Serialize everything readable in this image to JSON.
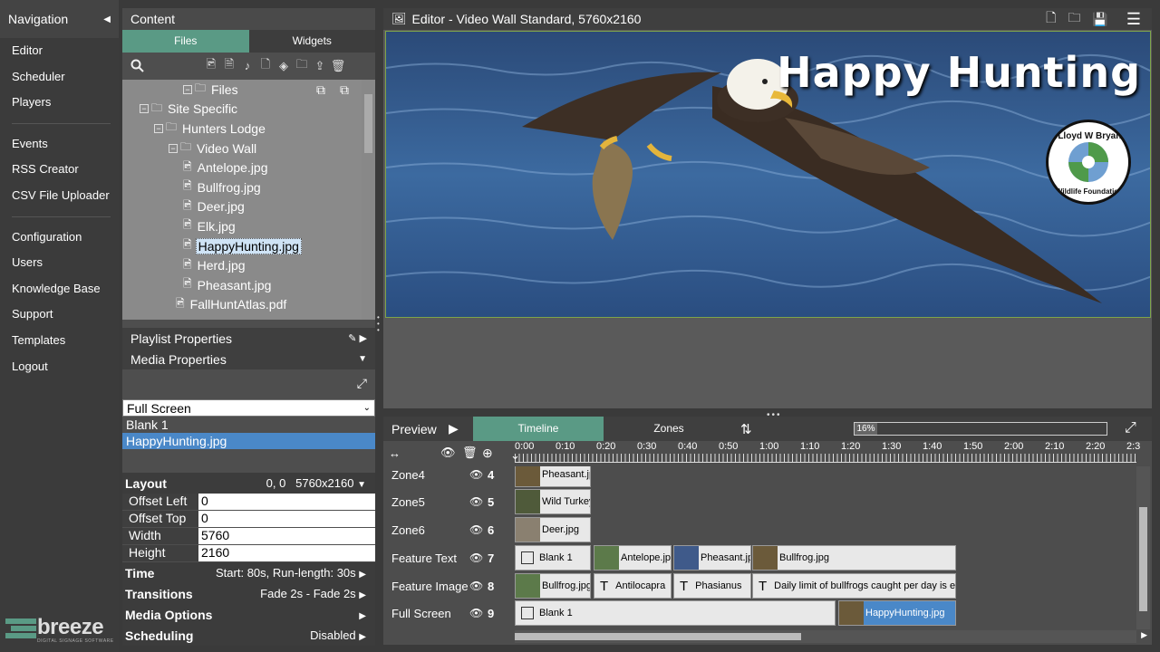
{
  "nav": {
    "title": "Navigation",
    "group1": [
      "Editor",
      "Scheduler",
      "Players"
    ],
    "group2": [
      "Events",
      "RSS Creator",
      "CSV File Uploader"
    ],
    "group3": [
      "Configuration",
      "Users",
      "Knowledge Base",
      "Support",
      "Templates",
      "Logout"
    ],
    "logo_text": "breeze",
    "logo_sub": "DIGITAL SIGNAGE SOFTWARE"
  },
  "content": {
    "title": "Content",
    "tabs": [
      "Files",
      "Widgets"
    ],
    "tree": [
      {
        "label": "Files",
        "type": "folder"
      },
      {
        "label": "Site Specific",
        "type": "folder"
      },
      {
        "label": "Hunters Lodge",
        "type": "folder"
      },
      {
        "label": "Video Wall",
        "type": "folder"
      },
      {
        "label": "Antelope.jpg",
        "type": "file"
      },
      {
        "label": "Bullfrog.jpg",
        "type": "file"
      },
      {
        "label": "Deer.jpg",
        "type": "file"
      },
      {
        "label": "Elk.jpg",
        "type": "file"
      },
      {
        "label": "HappyHunting.jpg",
        "type": "file",
        "selected": true
      },
      {
        "label": "Herd.jpg",
        "type": "file"
      },
      {
        "label": "Pheasant.jpg",
        "type": "file"
      },
      {
        "label": "FallHuntAtlas.pdf",
        "type": "file"
      }
    ],
    "playlist_properties": "Playlist Properties",
    "media_properties": "Media Properties",
    "zone_select": "Full Screen",
    "media_list": [
      "Blank 1",
      "HappyHunting.jpg"
    ],
    "layout": {
      "label": "Layout",
      "value": "0, 0   5760x2160"
    },
    "fields": [
      {
        "k": "Offset Left",
        "v": "0"
      },
      {
        "k": "Offset Top",
        "v": "0"
      },
      {
        "k": "Width",
        "v": "5760"
      },
      {
        "k": "Height",
        "v": "2160"
      }
    ],
    "time": {
      "label": "Time",
      "value": "Start: 80s, Run-length: 30s"
    },
    "transitions": {
      "label": "Transitions",
      "value": "Fade 2s - Fade 2s"
    },
    "media_options": {
      "label": "Media Options",
      "value": ""
    },
    "scheduling": {
      "label": "Scheduling",
      "value": "Disabled"
    }
  },
  "editor": {
    "title": "Editor - Video Wall Standard, 5760x2160",
    "headline": "Happy Hunting",
    "badge_top": "Lloyd W Bryant",
    "badge_bottom": "Wildlife Foundation"
  },
  "timeline": {
    "preview_label": "Preview",
    "tabs": [
      "Timeline",
      "Zones"
    ],
    "zoom": "16%",
    "ticks": [
      "0:00",
      "0:10",
      "0:20",
      "0:30",
      "0:40",
      "0:50",
      "1:00",
      "1:10",
      "1:20",
      "1:30",
      "1:40",
      "1:50",
      "2:00",
      "2:10",
      "2:20",
      "2:3"
    ],
    "zones": [
      {
        "name": "Zone4",
        "num": "4",
        "clips": [
          {
            "label": "Pheasant.jpg",
            "thumb": true
          }
        ]
      },
      {
        "name": "Zone5",
        "num": "5",
        "clips": [
          {
            "label": "Wild Turkey",
            "thumb": true
          }
        ]
      },
      {
        "name": "Zone6",
        "num": "6",
        "clips": [
          {
            "label": "Deer.jpg",
            "thumb": true
          }
        ]
      },
      {
        "name": "Feature Text",
        "num": "7",
        "clips": [
          {
            "label": "Blank 1",
            "kind": "blank"
          },
          {
            "label": "Antelope.jpg",
            "thumb": true
          },
          {
            "label": "Pheasant.jpg",
            "thumb": true
          },
          {
            "label": "Bullfrog.jpg",
            "thumb": true
          }
        ]
      },
      {
        "name": "Feature Image",
        "num": "8",
        "clips": [
          {
            "label": "Bullfrog.jpg",
            "thumb": true
          },
          {
            "label": "Antilocapra",
            "kind": "text"
          },
          {
            "label": "Phasianus",
            "kind": "text"
          },
          {
            "label": "Daily limit of bullfrogs caught per day is eight",
            "kind": "text"
          }
        ]
      },
      {
        "name": "Full Screen",
        "num": "9",
        "clips": [
          {
            "label": "Blank 1",
            "kind": "blank"
          },
          {
            "label": "HappyHunting.jpg",
            "thumb": true,
            "selected": true
          }
        ]
      }
    ]
  },
  "colors": {
    "accent": "#5a9a85",
    "selected": "#4a88c8"
  }
}
